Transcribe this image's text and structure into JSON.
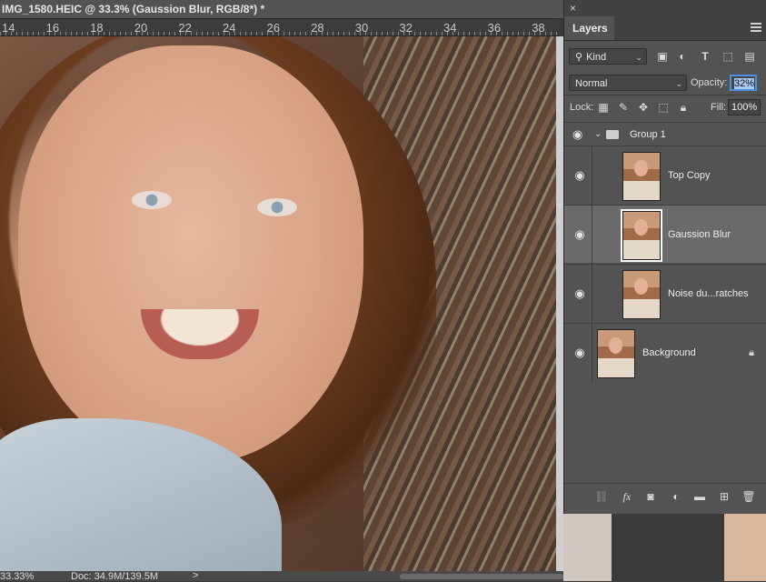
{
  "document": {
    "title": "IMG_1580.HEIC @ 33.3% (Gaussion Blur, RGB/8*) *"
  },
  "ruler": {
    "labels": [
      "14",
      "16",
      "18",
      "20",
      "22",
      "24",
      "26",
      "28",
      "30",
      "32",
      "34",
      "36",
      "38"
    ]
  },
  "status": {
    "zoom": "33.33%",
    "doc_size": "Doc: 34.9M/139.5M",
    "arrow": ">"
  },
  "layers_panel": {
    "close_glyph": "×",
    "tab_label": "Layers",
    "filter": {
      "label": "Kind",
      "icon": "search-icon"
    },
    "blend_mode": "Normal",
    "opacity_label": "Opacity:",
    "opacity_value": "32%",
    "lock_label": "Lock:",
    "fill_label": "Fill:",
    "fill_value": "100%",
    "group": {
      "name": "Group 1"
    },
    "layers": [
      {
        "name": "Top Copy",
        "selected": false,
        "locked": false
      },
      {
        "name": "Gaussion Blur",
        "selected": true,
        "locked": false
      },
      {
        "name": "Noise du...ratches",
        "selected": false,
        "locked": false
      },
      {
        "name": "Background",
        "selected": false,
        "locked": true
      }
    ],
    "bottom_icons": [
      "link-icon",
      "fx-icon",
      "mask-icon",
      "adjustment-icon",
      "folder-icon",
      "new-layer-icon",
      "trash-icon"
    ],
    "fx_text": "fx"
  },
  "colors": {
    "panel_bg": "#535353",
    "selected_layer": "#6a6a6a",
    "highlight": "#4a90e2"
  }
}
